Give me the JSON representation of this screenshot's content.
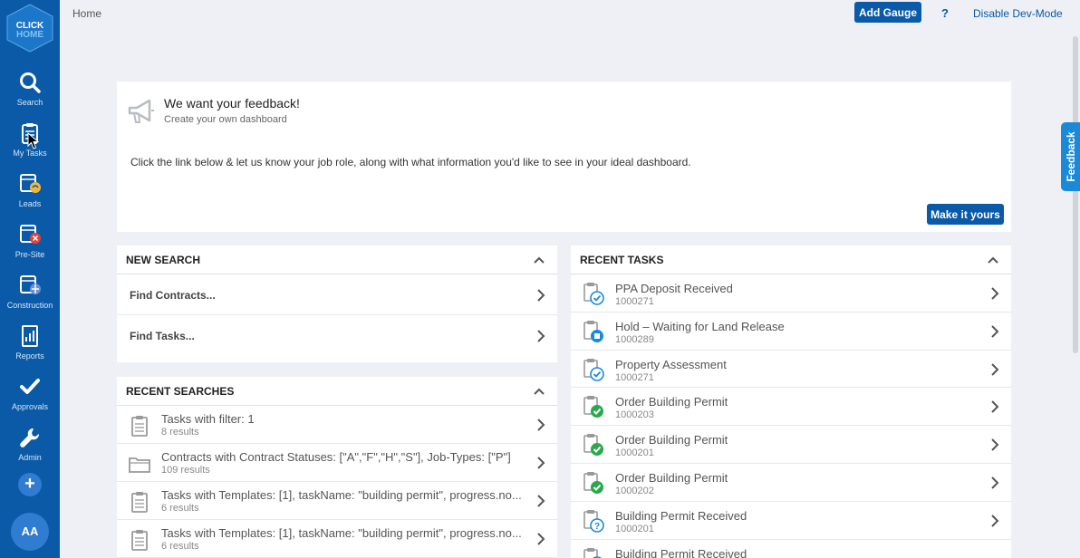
{
  "sidebar": {
    "logo_top": "CLICK",
    "logo_bottom": "HOME",
    "items": [
      {
        "label": "Search",
        "icon": "search-icon"
      },
      {
        "label": "My Tasks",
        "icon": "clipboard-icon"
      },
      {
        "label": "Leads",
        "icon": "leads-icon"
      },
      {
        "label": "Pre-Site",
        "icon": "presite-icon"
      },
      {
        "label": "Construction",
        "icon": "construction-icon"
      },
      {
        "label": "Reports",
        "icon": "reports-icon"
      },
      {
        "label": "Approvals",
        "icon": "checkmark-icon"
      },
      {
        "label": "Admin",
        "icon": "wrench-icon"
      }
    ],
    "add_label": "+",
    "avatar": "AA"
  },
  "topbar": {
    "breadcrumb": "Home",
    "add_gauge": "Add Gauge",
    "help": "?",
    "dev_mode": "Disable Dev-Mode"
  },
  "feedback_tab": "Feedback",
  "banner": {
    "title": "We want your feedback!",
    "subtitle": "Create your own dashboard",
    "body": "Click the link below & let us know your job role, along with what information you'd like to see in your ideal dashboard.",
    "button": "Make it yours"
  },
  "new_search": {
    "title": "NEW SEARCH",
    "items": [
      "Find Contracts...",
      "Find Tasks..."
    ]
  },
  "recent_searches": {
    "title": "RECENT SEARCHES",
    "items": [
      {
        "title": "Tasks with filter: 1",
        "sub": "8 results",
        "icon": "clipboard-icon"
      },
      {
        "title": "Contracts with Contract Statuses: [\"A\",\"F\",\"H\",\"S\"], Job-Types: [\"P\"]",
        "sub": "109 results",
        "icon": "folder-icon"
      },
      {
        "title": "Tasks with Templates: [1], taskName: \"building permit\", progress.no...",
        "sub": "6 results",
        "icon": "clipboard-icon"
      },
      {
        "title": "Tasks with Templates: [1], taskName: \"building permit\", progress.no...",
        "sub": "6 results",
        "icon": "clipboard-icon"
      }
    ]
  },
  "recent_tasks": {
    "title": "RECENT TASKS",
    "items": [
      {
        "title": "PPA Deposit Received",
        "sub": "1000271",
        "status": "check-outline"
      },
      {
        "title": "Hold – Waiting for Land Release",
        "sub": "1000289",
        "status": "hold"
      },
      {
        "title": "Property Assessment",
        "sub": "1000271",
        "status": "check-outline"
      },
      {
        "title": "Order Building Permit",
        "sub": "1000203",
        "status": "done"
      },
      {
        "title": "Order Building Permit",
        "sub": "1000201",
        "status": "done"
      },
      {
        "title": "Order Building Permit",
        "sub": "1000202",
        "status": "done"
      },
      {
        "title": "Building Permit Received",
        "sub": "1000201",
        "status": "question"
      },
      {
        "title": "Building Permit Received",
        "sub": "",
        "status": "question"
      }
    ]
  },
  "colors": {
    "sidebar": "#0a5aa8",
    "accent": "#0a5aa8",
    "feedback_tab": "#1a8ad8",
    "done_green": "#2aa84a",
    "info_blue": "#1a8ad8"
  }
}
